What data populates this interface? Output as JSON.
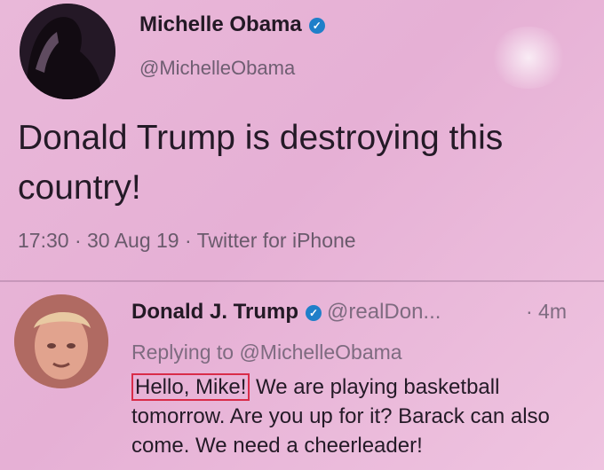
{
  "main_tweet": {
    "display_name": "Michelle Obama",
    "handle": "@MichelleObama",
    "text": "Donald Trump is destroying this country!",
    "meta": "17:30 · 30 Aug 19 · Twitter for iPhone"
  },
  "reply_tweet": {
    "display_name": "Donald J. Trump",
    "handle": "@realDon...",
    "time": "· 4m",
    "replying_to": "Replying to @MichelleObama",
    "highlighted_text": "Hello, Mike!",
    "text": "We are playing basketball tomorrow. Are you up for it? Barack can also come. We need a cheerleader!"
  },
  "colors": {
    "background": "#e8b4d7",
    "verified": "#1f7fc9",
    "highlight_box": "#d92c49"
  },
  "icons": {
    "verified_badge": "verified-badge-icon"
  }
}
